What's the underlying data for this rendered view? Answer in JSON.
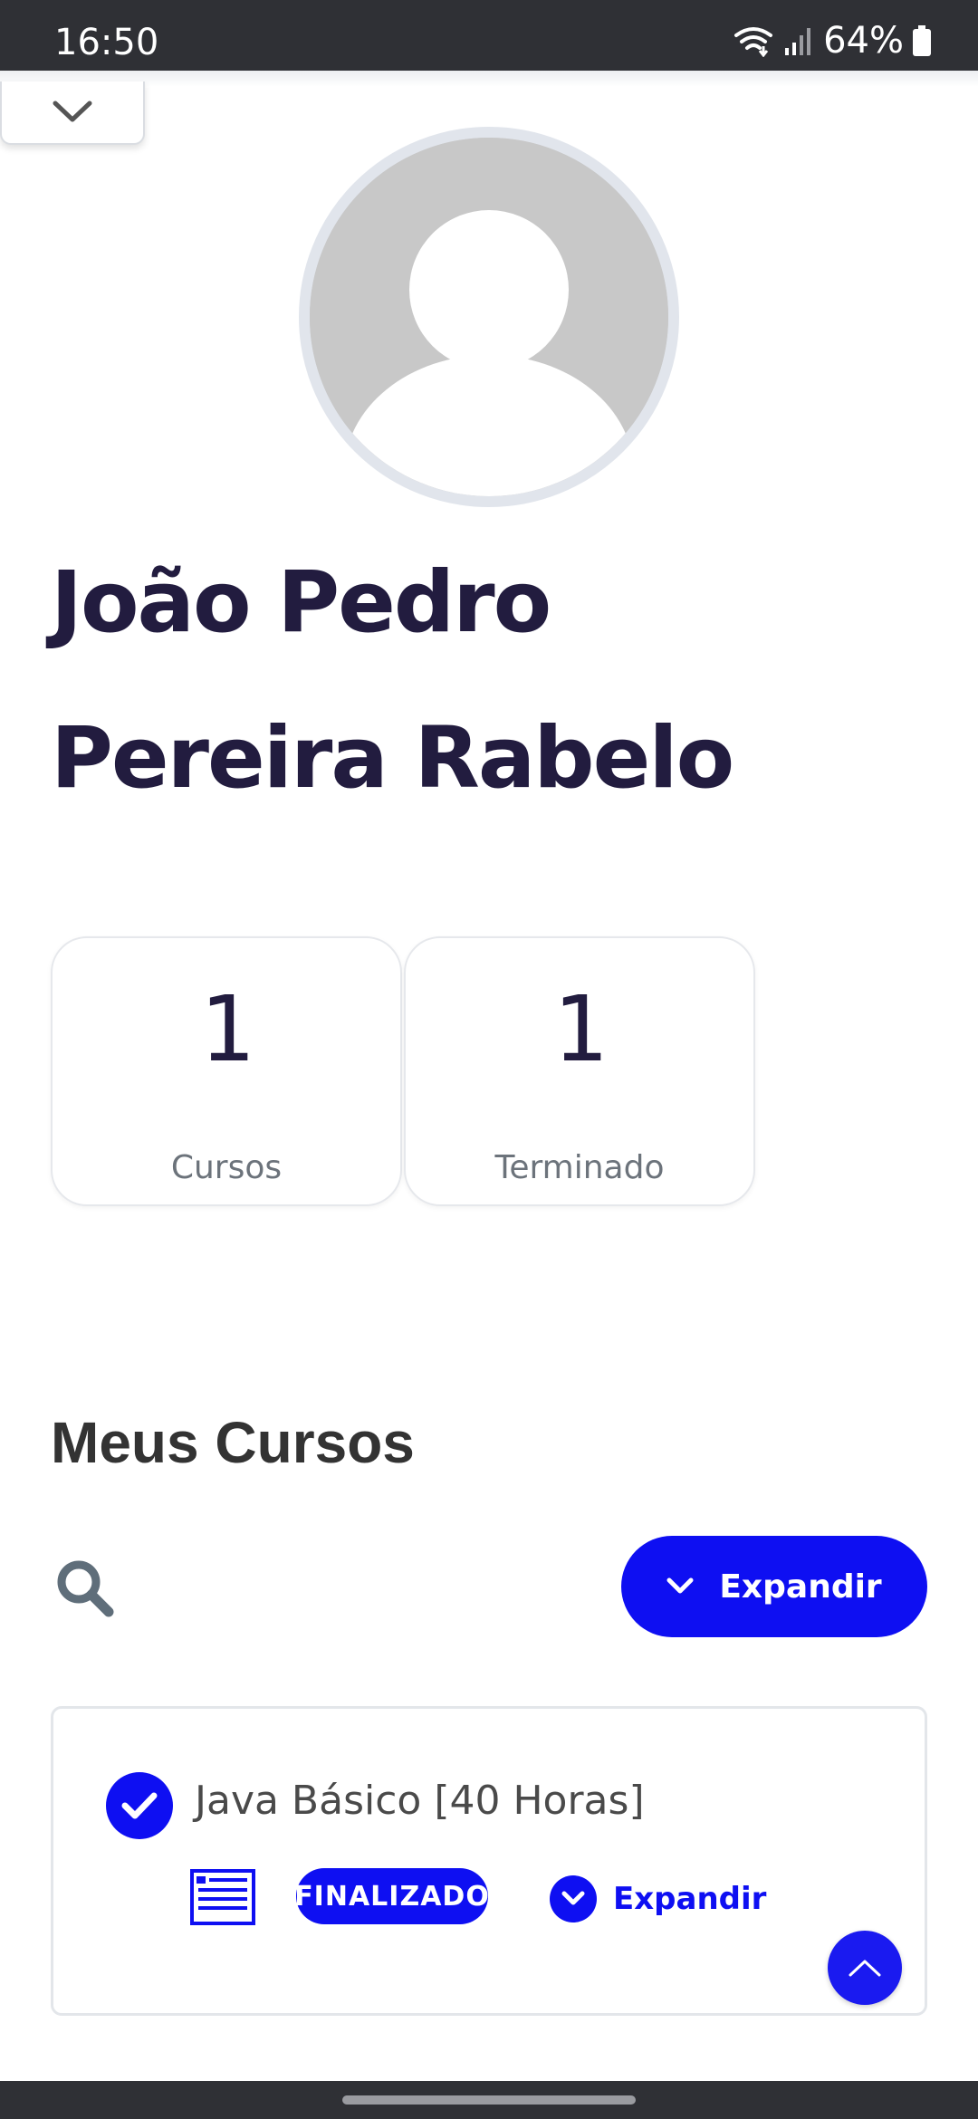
{
  "status_bar": {
    "time": "16:50",
    "battery": "64%",
    "icons": [
      "wifi-icon",
      "signal-icon",
      "battery-icon"
    ]
  },
  "profile": {
    "name": "João Pedro Pereira Rabelo",
    "avatar_icon": "avatar-placeholder-icon"
  },
  "stats": [
    {
      "value": "1",
      "label": "Cursos"
    },
    {
      "value": "1",
      "label": "Terminado"
    }
  ],
  "courses_section": {
    "title": "Meus Cursos",
    "search_icon": "search-icon",
    "expand_all_label": "Expandir"
  },
  "courses": [
    {
      "title": "Java Básico [40 Horas]",
      "status": "FINALIZADO",
      "expand_label": "Expandir",
      "completed": true
    }
  ],
  "colors": {
    "accent": "#0e0ff2",
    "heading": "#221c3f",
    "muted": "#6c737b",
    "status_bar": "#2f3035"
  }
}
